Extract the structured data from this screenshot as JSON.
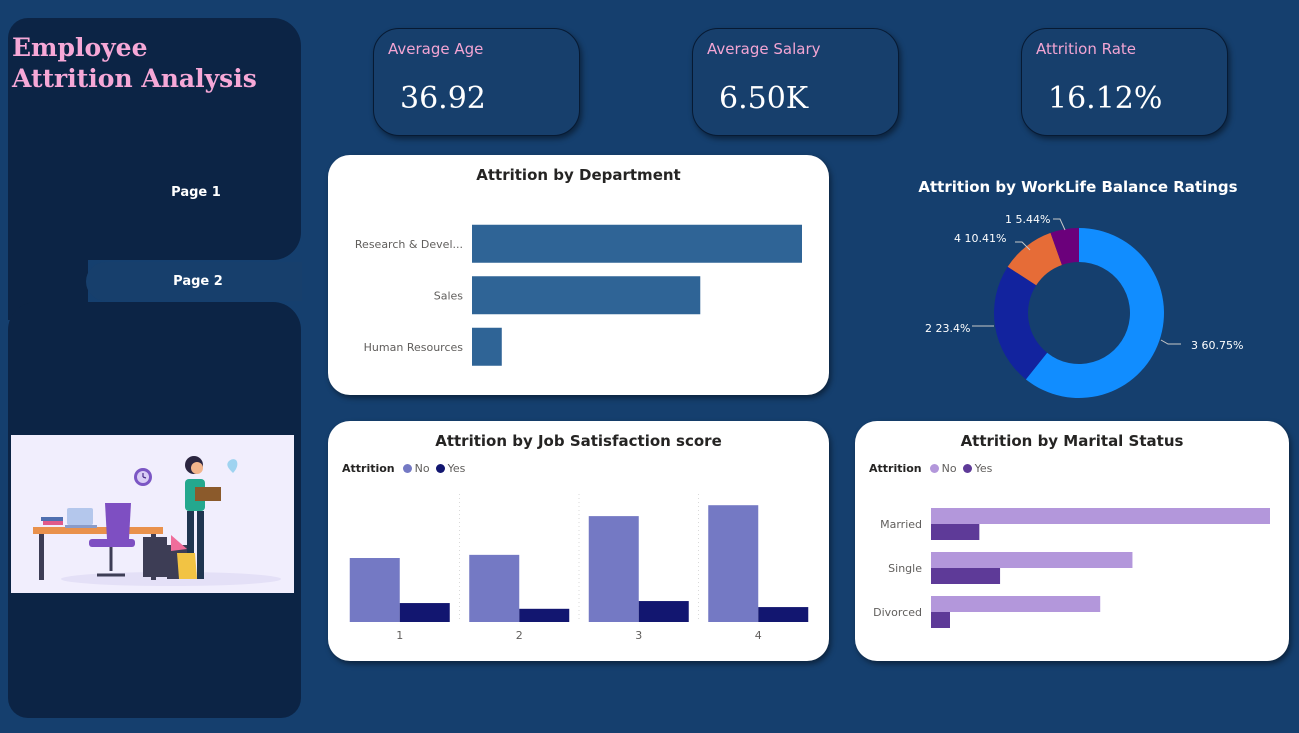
{
  "app": {
    "title_line1": "Employee",
    "title_line2": "Attrition Analysis"
  },
  "nav": {
    "pages": [
      {
        "label": "Page 1"
      },
      {
        "label": "Page 2"
      }
    ],
    "selected": "Page 2"
  },
  "kpis": [
    {
      "label": "Average Age",
      "value": "36.92"
    },
    {
      "label": "Average Salary",
      "value": "6.50K"
    },
    {
      "label": "Attrition Rate",
      "value": "16.12%"
    }
  ],
  "colors": {
    "background": "#153f6e",
    "sidebar": "#0c2445",
    "title_pink": "#f6a8d7",
    "dept_bar": "#2f6496",
    "js_no": "#7479c4",
    "js_yes": "#121670",
    "ms_no": "#b397db",
    "ms_yes": "#5e3a98",
    "wl_3": "#118dff",
    "wl_2": "#12239e",
    "wl_4": "#e66c37",
    "wl_1": "#6b007b"
  },
  "chart_data": [
    {
      "id": "department",
      "type": "bar",
      "orientation": "horizontal",
      "title": "Attrition by Department",
      "categories": [
        "Research & Devel...",
        "Sales",
        "Human Resources"
      ],
      "values": [
        133,
        92,
        12
      ],
      "xlim": [
        0,
        133
      ]
    },
    {
      "id": "worklife",
      "type": "pie",
      "donut": true,
      "title": "Attrition by WorkLife Balance Ratings",
      "slices": [
        {
          "category": "3",
          "percent": 60.75,
          "label": "3 60.75%"
        },
        {
          "category": "2",
          "percent": 23.4,
          "label": "2 23.4%"
        },
        {
          "category": "4",
          "percent": 10.41,
          "label": "4 10.41%"
        },
        {
          "category": "1",
          "percent": 5.44,
          "label": "1 5.44%"
        }
      ]
    },
    {
      "id": "job_satisfaction",
      "type": "bar",
      "title": "Attrition by Job Satisfaction score",
      "legend_title": "Attrition",
      "categories": [
        "1",
        "2",
        "3",
        "4"
      ],
      "series": [
        {
          "name": "No",
          "values": [
            223,
            234,
            369,
            407
          ]
        },
        {
          "name": "Yes",
          "values": [
            66,
            46,
            73,
            52
          ]
        }
      ],
      "ylim": [
        0,
        460
      ],
      "grid": false
    },
    {
      "id": "marital_status",
      "type": "bar",
      "orientation": "horizontal",
      "title": "Attrition by Marital Status",
      "legend_title": "Attrition",
      "categories": [
        "Married",
        "Single",
        "Divorced"
      ],
      "series": [
        {
          "name": "No",
          "values": [
            589,
            350,
            294
          ]
        },
        {
          "name": "Yes",
          "values": [
            84,
            120,
            33
          ]
        }
      ],
      "xlim": [
        0,
        589
      ]
    }
  ]
}
